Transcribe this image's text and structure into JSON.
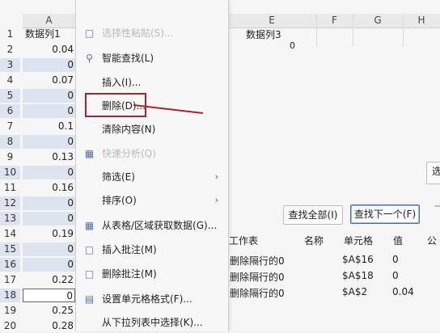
{
  "columns": {
    "A": "A",
    "E": "E",
    "F": "F",
    "G": "G",
    "H": "H"
  },
  "rows": [
    {
      "num": "1",
      "value": "数据列1",
      "sel": false
    },
    {
      "num": "2",
      "value": "0.04",
      "sel": false
    },
    {
      "num": "3",
      "value": "0",
      "sel": true
    },
    {
      "num": "4",
      "value": "0.07",
      "sel": false
    },
    {
      "num": "5",
      "value": "0",
      "sel": true
    },
    {
      "num": "6",
      "value": "0",
      "sel": true
    },
    {
      "num": "7",
      "value": "0.1",
      "sel": false
    },
    {
      "num": "8",
      "value": "0",
      "sel": true
    },
    {
      "num": "9",
      "value": "0.13",
      "sel": false
    },
    {
      "num": "10",
      "value": "0",
      "sel": true
    },
    {
      "num": "11",
      "value": "0.16",
      "sel": false
    },
    {
      "num": "12",
      "value": "0",
      "sel": true
    },
    {
      "num": "13",
      "value": "0",
      "sel": true
    },
    {
      "num": "14",
      "value": "0.19",
      "sel": false
    },
    {
      "num": "15",
      "value": "0",
      "sel": true
    },
    {
      "num": "16",
      "value": "0",
      "sel": true
    },
    {
      "num": "17",
      "value": "0.22",
      "sel": false
    },
    {
      "num": "18",
      "value": "0",
      "sel": true
    },
    {
      "num": "19",
      "value": "0.25",
      "sel": false
    },
    {
      "num": "20",
      "value": "0.28",
      "sel": false
    }
  ],
  "e1": "数据列3",
  "e2": "0",
  "menu": {
    "top_disabled": "选择性粘贴(S)...",
    "smart_find": "智能查找(L)",
    "insert": "插入(I)...",
    "delete": "删除(D)...",
    "clear": "清除内容(N)",
    "quick_analysis": "快速分析(Q)",
    "filter": "筛选(E)",
    "sort": "排序(O)",
    "get_data": "从表格/区域获取数据(G)...",
    "insert_comment": "插入批注(M)",
    "delete_comment": "删除批注(M)",
    "format_cells": "设置单元格格式(F)...",
    "pick_list": "从下拉列表中选择(K)..."
  },
  "find": {
    "find_all": "查找全部(I)",
    "find_next": "查找下一个(F)",
    "options": "选",
    "headers": {
      "sheet": "工作表",
      "name": "名称",
      "cell": "单元格",
      "value": "值",
      "formula": "公"
    },
    "results": [
      {
        "sheet": "删除隔行的0",
        "cell": "$A$16",
        "value": "0"
      },
      {
        "sheet": "删除隔行的0",
        "cell": "$A$18",
        "value": "0"
      },
      {
        "sheet": "删除隔行的0",
        "cell": "$A$2",
        "value": "0.04"
      }
    ]
  },
  "colors": {
    "annotation": "#a5262e",
    "selection": "#dde3ef",
    "icon": "#5b6fa8"
  }
}
